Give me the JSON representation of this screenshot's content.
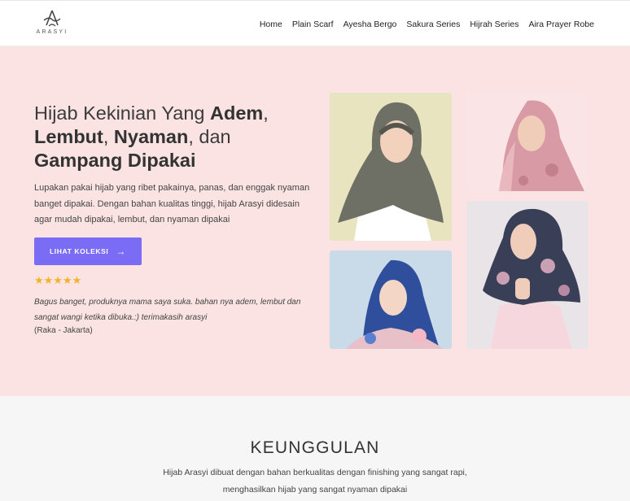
{
  "header": {
    "logo_text": "ARASYI",
    "nav": [
      "Home",
      "Plain Scarf",
      "Ayesha Bergo",
      "Sakura Series",
      "Hijrah Series",
      "Aira Prayer Robe"
    ]
  },
  "hero": {
    "title_parts": [
      "Hijab Kekinian Yang ",
      "Adem",
      ",",
      "Lembut",
      ", ",
      "Nyaman",
      ", dan",
      "Gampang Dipakai"
    ],
    "description": "Lupakan pakai hijab yang ribet pakainya, panas, dan enggak nyaman banget dipakai. Dengan bahan kualitas tinggi, hijab Arasyi didesain agar mudah dipakai, lembut, dan nyaman dipakai",
    "cta_label": "LIHAT KOLEKSI",
    "rating_stars": 5,
    "rating_glyphs": "★★★★★",
    "review": "Bagus banget, produknya mama saya suka. bahan nya adem, lembut dan sangat wangi ketika dibuka.:) terimakasih arasyi",
    "reviewer": "(Raka - Jakarta)"
  },
  "photos": [
    {
      "name": "olive-hijab-photo",
      "bg": "#e8e4bf",
      "scarf": "#6e7066",
      "face": "#f2d2bd"
    },
    {
      "name": "pink-floral-hijab-photo",
      "bg": "#fbe4e6",
      "scarf": "#d89aa4",
      "face": "#f0cdb8"
    },
    {
      "name": "blue-floral-hijab-photo",
      "bg": "#c9dbe8",
      "scarf": "#2f4f9c",
      "face": "#f4d6c6"
    },
    {
      "name": "navy-floral-hijab-photo",
      "bg": "#e9e4e7",
      "scarf": "#3a3f58",
      "face": "#f0cdbb"
    }
  ],
  "features": {
    "heading": "KEUNGGULAN",
    "text": "Hijab Arasyi dibuat dengan bahan berkualitas dengan finishing yang sangat rapi, menghasilkan hijab yang sangat nyaman dipakai"
  },
  "colors": {
    "hero_bg": "#fbe3e3",
    "cta": "#7b6cf6",
    "star": "#f0b429",
    "features_bg": "#f6f6f6"
  }
}
